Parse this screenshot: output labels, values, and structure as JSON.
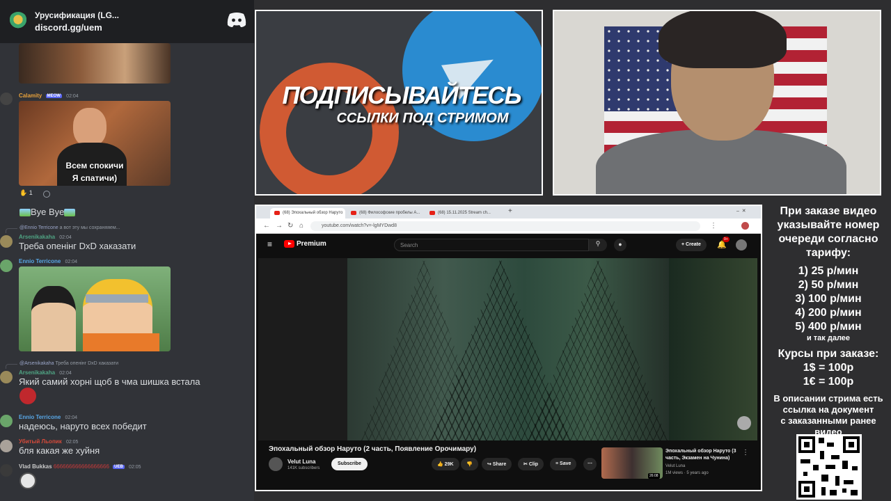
{
  "discord": {
    "server_name": "Урусификация (LG...",
    "invite": "discord.gg/uem",
    "messages": [
      {
        "user": "Calamity",
        "badge": "MEOW",
        "time": "02:04",
        "image_caption_line1": "Всем спокичи",
        "image_caption_line2": "Я спатичи)",
        "reaction_count": "1"
      },
      {
        "text": "Bye Bye"
      },
      {
        "reply_to": "@Ennio Terricone",
        "reply_text": "а вот эту мы сохраняяем...",
        "user": "Arsenikakaha",
        "time": "02:04",
        "text": "Треба опенінг DxD хаказати"
      },
      {
        "user": "Ennio Terricone",
        "time": "02:04"
      },
      {
        "reply_to": "@Arsenikakaha",
        "reply_text": "Треба опенінг DxD хаказати",
        "user": "Arsenikakaha",
        "time": "02:04",
        "text": "Який самий хорні щоб в чма шишка встала"
      },
      {
        "user": "Ennio Terricone",
        "time": "02:04",
        "text": "надеюсь, наруто всех победит"
      },
      {
        "user": "Убитый Льопик",
        "time": "02:05",
        "text": "бля какая же хуйня"
      },
      {
        "user": "Vlad Bukkas",
        "extra": "666666666666666666",
        "badge": "UEB",
        "time": "02:05"
      }
    ]
  },
  "promo": {
    "title": "ПОДПИСЫВАЙТЕСЬ",
    "subtitle": "ССЫЛКИ ПОД СТРИМОМ"
  },
  "browser": {
    "tabs": [
      {
        "label": "(68) Эпохальный обзор Наруто"
      },
      {
        "label": "(68) Философские пробелы А..."
      },
      {
        "label": "(68) 15.11.2025 Stream ch..."
      }
    ],
    "url": "youtube.com/watch?v=-lgMYDwd8",
    "youtube": {
      "brand": "Premium",
      "search_placeholder": "Search",
      "create_label": "Create",
      "notif_badge": "9+",
      "video_title": "Эпохальный обзор Наруто (2 часть, Появление Орочимару)",
      "channel_name": "Velut Luna",
      "channel_subs": "141K subscribers",
      "subscribe_label": "Subscribe",
      "likes": "29K",
      "share_label": "Share",
      "clip_label": "Clip",
      "save_label": "Save",
      "rec_title": "Эпохальный обзор Наруто (3 часть, Экзамен на Чунина)",
      "rec_channel": "Velut Luna",
      "rec_meta": "1M views · 5 years ago",
      "rec_duration": "26:08"
    }
  },
  "info": {
    "line1": "При заказе видео",
    "line2": "указывайте номер",
    "line3": "очереди согласно",
    "line4": "тарифу:",
    "tariffs": [
      "1) 25 р/мин",
      "2) 50 р/мин",
      "3) 100 р/мин",
      "4) 200 р/мин",
      "5) 400 р/мин"
    ],
    "tariff_more": "и так далее",
    "rates_title": "Курсы при заказе:",
    "rate_usd": "1$ = 100р",
    "rate_eur": "1€ = 100р",
    "doc_line1": "В описании стрима есть",
    "doc_line2": "ссылка на документ",
    "doc_line3": "с заказанными ранее",
    "doc_line4": "видео"
  },
  "colors": {
    "discord_bg": "#313338",
    "discord_header": "#1e1f22",
    "yt_red": "#ff0000",
    "telegram_blue": "#2a8bd0",
    "patreon_orange": "#d05a33"
  }
}
